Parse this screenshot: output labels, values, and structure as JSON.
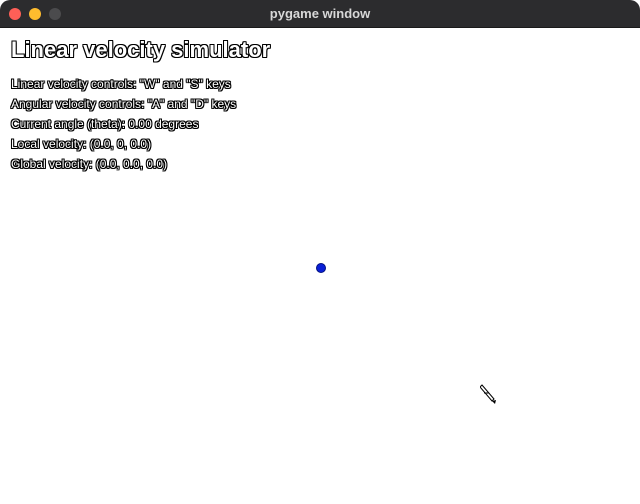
{
  "window": {
    "title": "pygame window"
  },
  "simulator": {
    "heading": "Linear velocity simulator",
    "linear_controls": "Linear velocity controls: \"W\" and \"S\" keys",
    "angular_controls": "Angular velocity controls: \"A\" and \"D\" keys",
    "current_angle": "Current angle (theta): 0.00 degrees",
    "local_velocity": "Local velocity: (0.0, 0, 0.0)",
    "global_velocity": "Global velocity: (0.0, 0.0, 0.0)"
  },
  "colors": {
    "agent": "#0a1fd6",
    "titlebar": "#2c2c2e",
    "close": "#fe5f57",
    "minimize": "#febc2e",
    "maximize": "#4b4b4d"
  },
  "icons": {
    "cursor": "pen-cursor-icon"
  }
}
